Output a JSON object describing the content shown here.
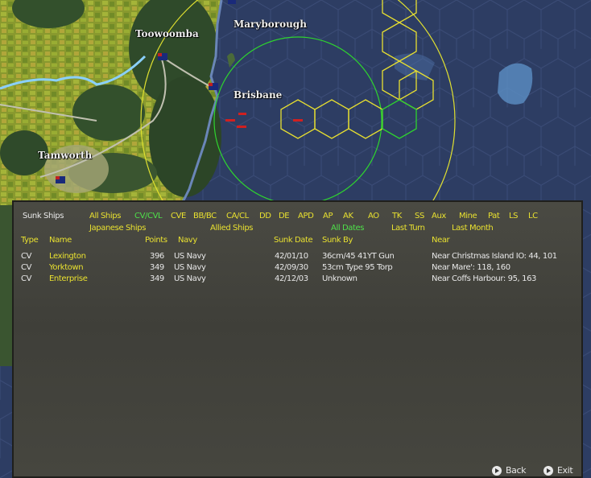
{
  "map": {
    "cities": [
      "Toowoomba",
      "Maryborough",
      "Brisbane",
      "Tamworth"
    ]
  },
  "panel": {
    "title": "Sunk Ships",
    "filters_row1": [
      "All Ships",
      "CV/CVL",
      "CVE",
      "BB/BC",
      "CA/CL",
      "DD",
      "DE",
      "APD",
      "AP",
      "AK",
      "AO",
      "TK",
      "SS",
      "Aux",
      "Mine",
      "Pat",
      "LS",
      "LC"
    ],
    "filters_row2": [
      "Japanese Ships",
      "Allied Ships",
      "All Dates",
      "Last Turn",
      "Last Month"
    ],
    "columns": [
      "Type",
      "Name",
      "Points",
      "Navy",
      "Sunk Date",
      "Sunk By",
      "Near"
    ],
    "rows": [
      {
        "type": "CV",
        "name": "Lexington",
        "points": "396",
        "navy": "US Navy",
        "date": "42/01/10",
        "by": "36cm/45 41YT Gun",
        "near": "Near Christmas Island IO: 44, 101"
      },
      {
        "type": "CV",
        "name": "Yorktown",
        "points": "349",
        "navy": "US Navy",
        "date": "42/09/30",
        "by": "53cm Type 95 Torp",
        "near": "Near Mare': 118, 160"
      },
      {
        "type": "CV",
        "name": "Enterprise",
        "points": "349",
        "navy": "US Navy",
        "date": "42/12/03",
        "by": "Unknown",
        "near": "Near Coffs Harbour: 95, 163"
      }
    ],
    "buttons": {
      "back": "Back",
      "exit": "Exit"
    }
  },
  "colors": {
    "highlight_yellow": "#e8e030",
    "active_green": "#4ee04a",
    "text": "#e8e8e8",
    "ocean": "#2a3a5e"
  }
}
